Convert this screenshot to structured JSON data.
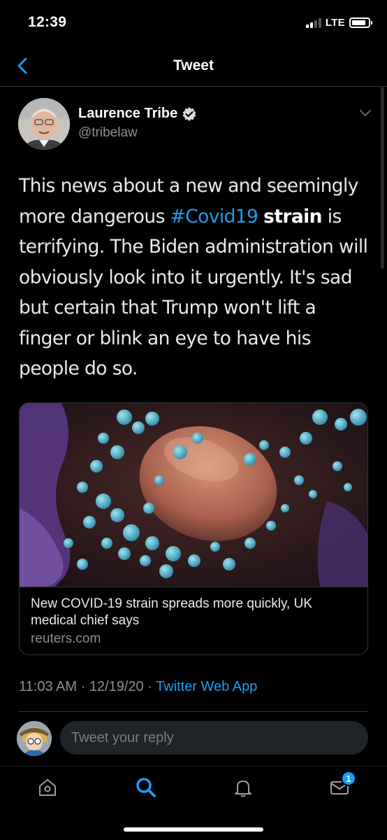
{
  "status_bar": {
    "time": "12:39",
    "network": "LTE"
  },
  "nav": {
    "title": "Tweet"
  },
  "author": {
    "name": "Laurence Tribe",
    "handle": "@tribelaw"
  },
  "tweet": {
    "text_parts": [
      "This news about a new and seemingly more dangerous ",
      "#Covid19",
      " ",
      "strain",
      " is terrifying. The Biden administration will obviously look into it urgently. It's sad but certain that Trump won't lift a finger or blink an eye to have his people do so."
    ]
  },
  "card": {
    "title": "New COVID-19 strain spreads more quickly, UK medical chief says",
    "domain": "reuters.com"
  },
  "meta": {
    "time": "11:03 AM",
    "separator": " · ",
    "date": "12/19/20",
    "separator2": " · ",
    "app": "Twitter Web App"
  },
  "reply": {
    "placeholder": "Tweet your reply"
  },
  "tabs": {
    "messages_badge": "1"
  },
  "colors": {
    "accent": "#1d9bf0",
    "background": "#000000",
    "muted": "#8b8f94"
  }
}
